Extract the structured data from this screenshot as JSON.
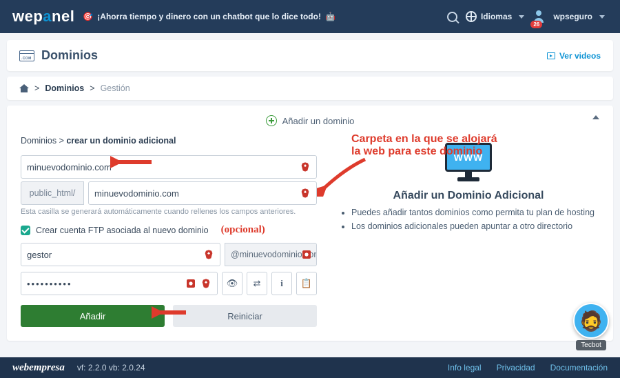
{
  "header": {
    "logo_pre": "wep",
    "logo_mid": "a",
    "logo_post": "nel",
    "promo": "¡Ahorra tiempo y dinero con un chatbot que lo dice todo!",
    "lang_label": "Idiomas",
    "user_label": "wpseguro",
    "badge": "26"
  },
  "page_title": "Dominios",
  "ver_videos": "Ver videos",
  "bc": {
    "l1": "Dominios",
    "l2": "Gestión"
  },
  "section_title": "Añadir un dominio",
  "sub_bc": {
    "a": "Dominios",
    "b": "crear un dominio adicional"
  },
  "fields": {
    "domain": "minuevodominio.com",
    "path_prefix": "public_html/",
    "path_value": "minuevodominio.com",
    "hint": "Esta casilla se generará automáticamente cuando rellenes los campos anteriores.",
    "chk_label": "Crear cuenta FTP asociada al nuevo dominio",
    "opt": "(opcional)",
    "ftp_user": "gestor",
    "ftp_domain": "@minuevodominio.com",
    "password": "••••••••••"
  },
  "buttons": {
    "add": "Añadir",
    "reset": "Reiniciar"
  },
  "right": {
    "www": "WWW",
    "title": "Añadir un Dominio Adicional",
    "li1": "Puedes añadir tantos dominios como permita tu plan de hosting",
    "li2": "Los dominios adicionales pueden apuntar a otro directorio"
  },
  "anno": {
    "l1": "Carpeta en la que se alojará",
    "l2": "la web para este dominio"
  },
  "tecbot": "Tecbot",
  "footer": {
    "brand": "webempresa",
    "ver": "vf: 2.2.0 vb: 2.0.24",
    "a": "Info legal",
    "b": "Privacidad",
    "c": "Documentación"
  }
}
